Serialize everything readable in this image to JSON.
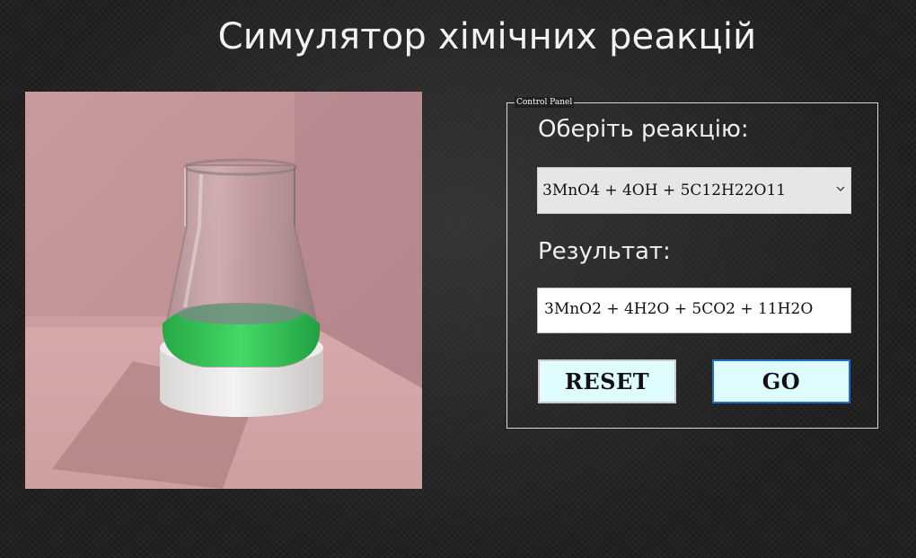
{
  "app": {
    "title": "Симулятор хімічних реакцій"
  },
  "scene": {
    "liquid_color": "#38c65a",
    "wall_color": "#c89a9c"
  },
  "control_panel": {
    "legend": "Control Panel",
    "select_label": "Оберіть реакцію:",
    "selected_reaction": "3MnO4 + 4OH + 5C12H22O11",
    "result_label": "Результат:",
    "result_value": "3MnO2 + 4H2O + 5CO2 + 11H2O",
    "reset_label": "RESET",
    "go_label": "GO",
    "go_border_color": "#1f6fc8",
    "button_bg_color": "#dffcff"
  }
}
